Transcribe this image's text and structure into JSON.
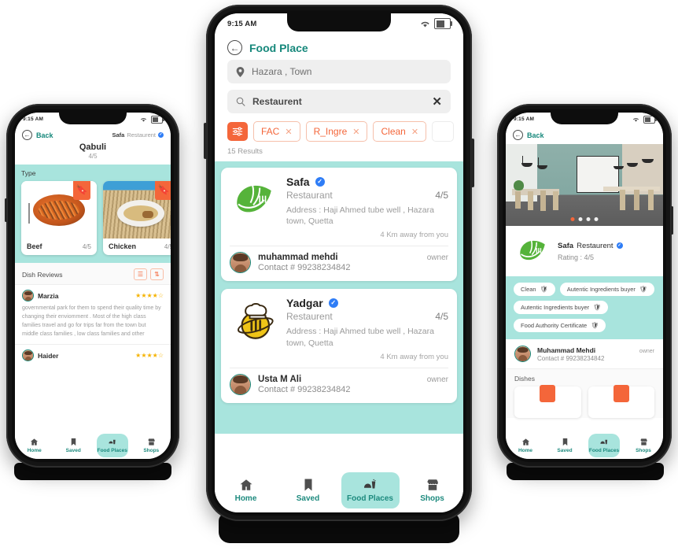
{
  "status_bar": {
    "time": "9:15 AM",
    "wifi_icon": "wifi-icon",
    "battery_icon": "battery-icon"
  },
  "bottom_nav": {
    "items": [
      {
        "label": "Home",
        "icon": "home-icon",
        "active": false
      },
      {
        "label": "Saved",
        "icon": "bookmark-icon",
        "active": false
      },
      {
        "label": "Food Places",
        "icon": "food-places-icon",
        "active": true
      },
      {
        "label": "Shops",
        "icon": "shop-icon",
        "active": false
      }
    ]
  },
  "colors": {
    "teal_accent": "#16887b",
    "teal_band": "#a8e4dd",
    "orange": "#f4663a",
    "verified_blue": "#2f7df6",
    "star_gold": "#f5b301"
  },
  "left_phone": {
    "back_label": "Back",
    "badge_name": "Safa",
    "badge_type": "Restaurent",
    "badge_verified_icon": "verified-icon",
    "dish_title": "Qabuli",
    "dish_rating": "4/5",
    "type_section_label": "Type",
    "types": [
      {
        "name": "Beef",
        "rating": "4/5",
        "bookmark_icon": "bookmark-icon"
      },
      {
        "name": "Chicken",
        "rating": "4/5",
        "bookmark_icon": "bookmark-icon"
      }
    ],
    "reviews_header": "Dish Reviews",
    "filter_icon": "filter-icon",
    "sort_icon": "sort-icon",
    "reviews": [
      {
        "author": "Marzia",
        "stars": "★★★★☆",
        "text": "governmental park for them to spend their quality time by changing their enviomment . Most of the high class families travel and go for trips far from the town but middle class families , low class families and other"
      },
      {
        "author": "Haider",
        "stars": "★★★★☆",
        "text": ""
      }
    ]
  },
  "mid_phone": {
    "header_title": "Food Place",
    "back_icon": "back-arrow-icon",
    "location_field": {
      "value": "Hazara , Town",
      "icon": "location-pin-icon"
    },
    "search_field": {
      "value": "Restaurent",
      "icon": "search-icon",
      "clear_icon": "close-icon"
    },
    "filter_button_icon": "filter-settings-icon",
    "chips": [
      {
        "label": "FAC",
        "remove_icon": "close-icon"
      },
      {
        "label": "R_Ingre",
        "remove_icon": "close-icon"
      },
      {
        "label": "Clean",
        "remove_icon": "close-icon"
      }
    ],
    "results_count": "15 Results",
    "restaurants": [
      {
        "name": "Safa",
        "verified_icon": "verified-icon",
        "type": "Restaurant",
        "rating": "4/5",
        "address": "Address : Haji Ahmed tube well , Hazara town, Quetta",
        "distance": "4 Km away from you",
        "logo_icon": "leaf-fork-logo",
        "owner": {
          "name": "muhammad mehdi",
          "role": "owner",
          "contact": "Contact # 99238234842",
          "avatar": "owner-avatar"
        }
      },
      {
        "name": "Yadgar",
        "verified_icon": "verified-icon",
        "type": "Restaurent",
        "rating": "4/5",
        "address": "Address : Haji Ahmed tube well , Hazara town, Quetta",
        "distance": "4 Km away from you",
        "logo_icon": "chef-bee-logo",
        "owner": {
          "name": "Usta M Ali",
          "role": "owner",
          "contact": "Contact # 99238234842",
          "avatar": "owner-avatar"
        }
      }
    ]
  },
  "right_phone": {
    "back_label": "Back",
    "gallery": {
      "dot_count": 4,
      "active_dot": 0,
      "image_alt": "restaurant-interior-photo"
    },
    "business": {
      "name": "Safa",
      "type": "Restaurent",
      "verified_icon": "verified-icon",
      "rating": "Rating : 4/5",
      "logo_icon": "leaf-fork-logo"
    },
    "tags": [
      {
        "label": "Clean",
        "icon": "shield-icon"
      },
      {
        "label": "Autentic Ingredients buyer",
        "icon": "shield-icon"
      },
      {
        "label": "Autentic Ingredients buyer",
        "icon": "shield-icon"
      },
      {
        "label": "Food Authority Certificate",
        "icon": "shield-icon"
      }
    ],
    "owner": {
      "name": "Muhammad Mehdi",
      "role": "owner",
      "contact": "Contact # 99238234842",
      "avatar": "owner-avatar"
    },
    "dishes_label": "Dishes",
    "dishes": [
      {
        "bookmark_icon": "bookmark-icon"
      },
      {
        "bookmark_icon": "bookmark-icon"
      }
    ]
  }
}
